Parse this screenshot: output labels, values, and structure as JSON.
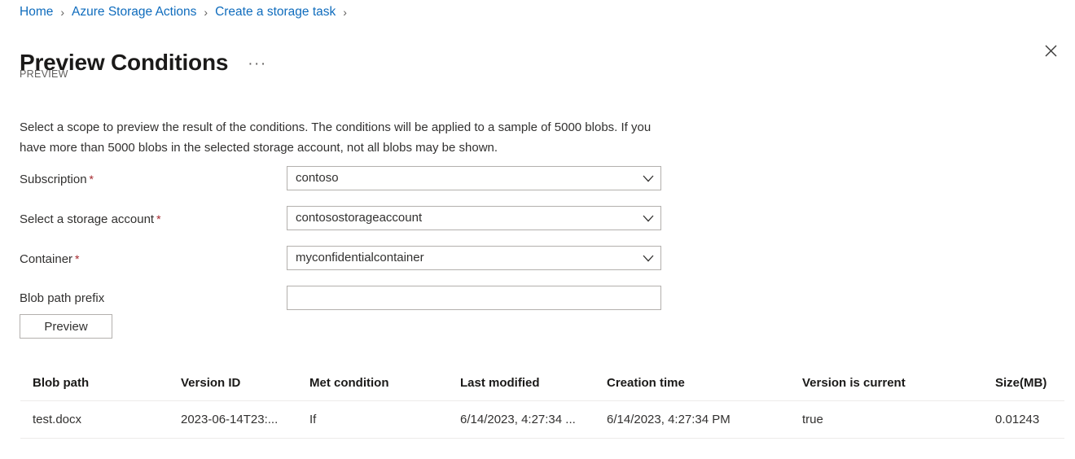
{
  "breadcrumb": {
    "items": [
      {
        "label": "Home"
      },
      {
        "label": "Azure Storage Actions"
      },
      {
        "label": "Create a storage task"
      }
    ],
    "separator": "›"
  },
  "header": {
    "title": "Preview Conditions",
    "overflow_menu": "···",
    "preview_tag": "PREVIEW",
    "close_icon": "close-icon"
  },
  "description": "Select a scope to preview the result of the conditions. The conditions will be applied to a sample of 5000 blobs. If you have more than 5000 blobs in the selected storage account, not all blobs may be shown.",
  "form": {
    "fields": [
      {
        "label": "Subscription",
        "required": true,
        "value": "contoso",
        "placeholder": "",
        "type": "dropdown"
      },
      {
        "label": "Select a storage account",
        "required": true,
        "value": "contosostorageaccount",
        "placeholder": "",
        "type": "dropdown"
      },
      {
        "label": "Container",
        "required": true,
        "value": "myconfidentialcontainer",
        "placeholder": "",
        "type": "dropdown"
      },
      {
        "label": "Blob path prefix",
        "required": false,
        "value": "",
        "placeholder": "",
        "type": "text"
      }
    ],
    "required_marker": "*",
    "preview_button": "Preview"
  },
  "table": {
    "columns": [
      "Blob path",
      "Version ID",
      "Met condition",
      "Last modified",
      "Creation time",
      "Version is current",
      "Size(MB)"
    ],
    "rows": [
      {
        "blob_path": "test.docx",
        "version_id": "2023-06-14T23:...",
        "met_condition": "If",
        "last_modified": "6/14/2023, 4:27:34 ...",
        "creation_time": "6/14/2023, 4:27:34 PM",
        "version_is_current": "true",
        "size_mb": "0.01243"
      }
    ]
  },
  "colors": {
    "link": "#0f6cbd",
    "required": "#a4262c",
    "text": "#323130",
    "muted": "#605e5c",
    "border": "#b3b0ad",
    "row_divider": "#edebe9",
    "background": "#ffffff"
  }
}
